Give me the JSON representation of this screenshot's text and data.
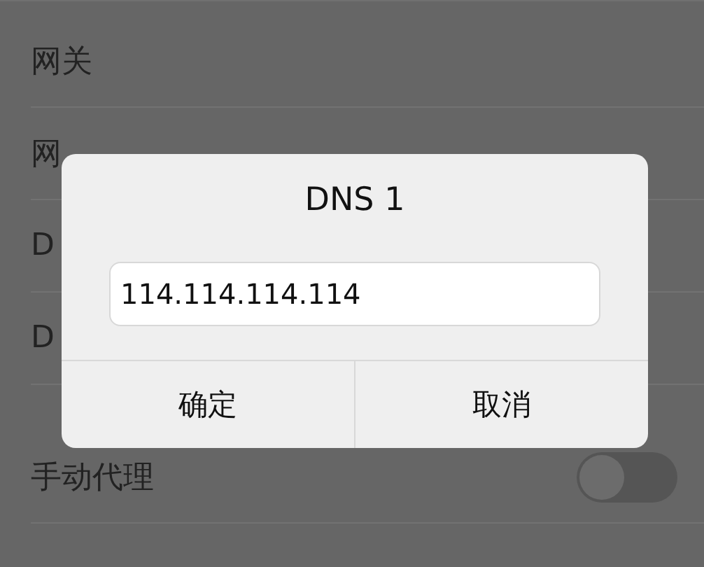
{
  "settings": [
    {
      "kind": "text",
      "label": "网关"
    },
    {
      "kind": "text",
      "label": "网"
    },
    {
      "kind": "text",
      "label": "D"
    },
    {
      "kind": "text",
      "label": "D"
    },
    {
      "kind": "toggle",
      "label": "手动代理",
      "on": false
    }
  ],
  "dialog": {
    "title": "DNS 1",
    "value": "114.114.114.114",
    "buttons": [
      "确定",
      "取消"
    ]
  }
}
